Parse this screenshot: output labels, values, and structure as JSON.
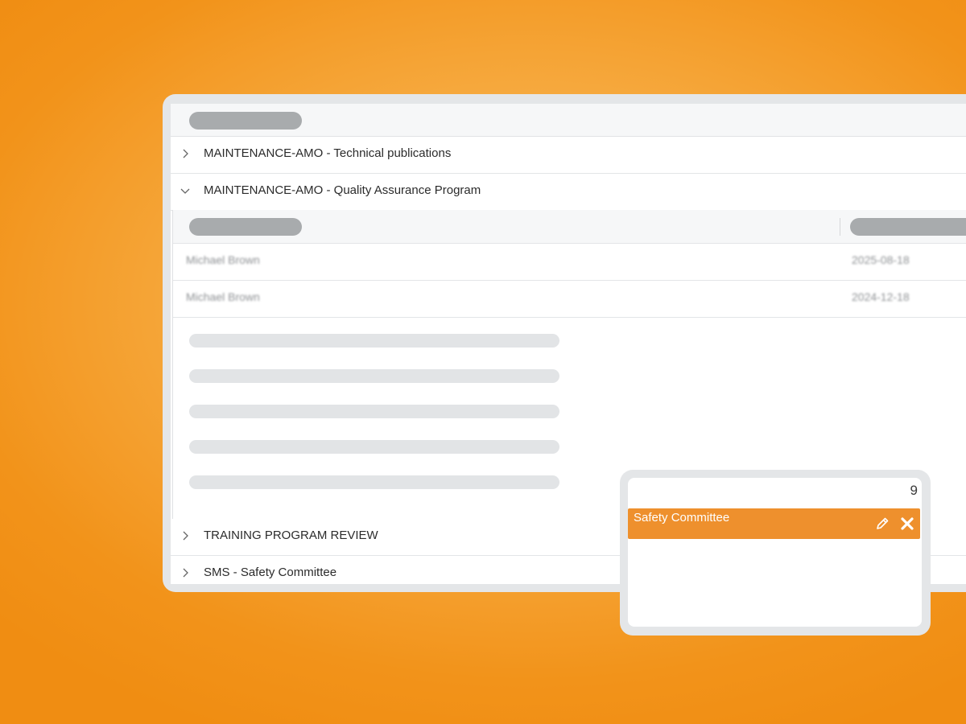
{
  "groups": {
    "technical_publications": "MAINTENANCE-AMO - Technical publications",
    "quality_assurance": "MAINTENANCE-AMO - Quality Assurance Program",
    "training_review": "TRAINING PROGRAM REVIEW",
    "sms_safety": "SMS - Safety Committee"
  },
  "expanded_rows": [
    {
      "name": "Michael Brown",
      "date": "2025-08-18"
    },
    {
      "name": "Michael Brown",
      "date": "2024-12-18"
    }
  ],
  "popup": {
    "count": "9",
    "item_label": "Safety Committee"
  },
  "icons": {
    "collapsed": "chevron-right-icon",
    "expanded": "chevron-down-icon",
    "edit": "pencil-icon",
    "remove": "close-icon"
  },
  "colors": {
    "accent": "#ee902d",
    "background": "#f6a93e"
  }
}
